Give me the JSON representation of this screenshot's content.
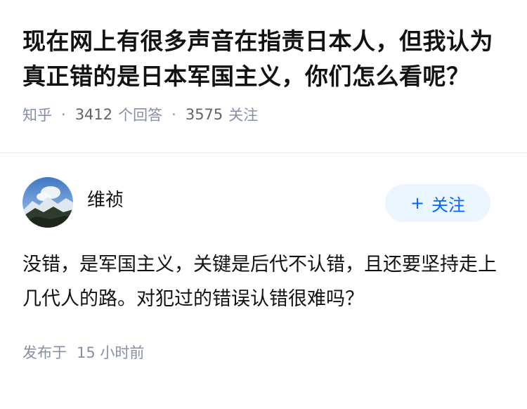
{
  "question": {
    "title": "现在网上有很多声音在指责日本人，但我认为真正错的是日本军国主义，你们怎么看呢？",
    "source": "知乎",
    "separator": "·",
    "answer_count": "3412",
    "answer_label": "个回答",
    "follow_count": "3575",
    "follow_label": "关注"
  },
  "answer": {
    "author": "维祯",
    "follow_button": {
      "plus": "+",
      "label": "关注"
    },
    "content": "没错，是军国主义，关键是后代不认错，且还要坚持走上几代人的路。对犯过的错误认错很难吗？",
    "published_label": "发布于",
    "published_time": "15 小时前"
  },
  "colors": {
    "accent": "#0066ff",
    "button_bg": "#ebf5ff",
    "meta_gray": "#8590a6"
  }
}
